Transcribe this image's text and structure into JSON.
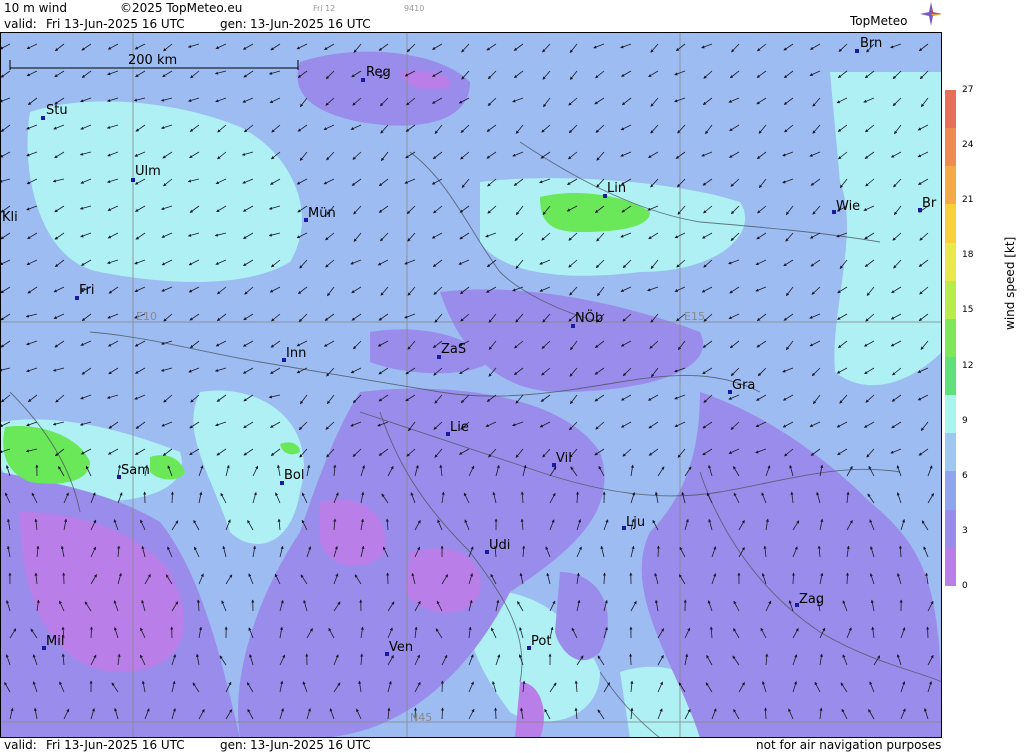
{
  "header": {
    "product": "10 m wind",
    "copyright": "©2025 TopMeteo.eu",
    "tiny_day": "Fri 12",
    "tiny_code": "9410",
    "valid_label": "valid:",
    "valid_time": "Fri 13-Jun-2025 16 UTC",
    "gen_label": "gen:",
    "gen_time": "13-Jun-2025 16 UTC",
    "brand": "TopMeteo"
  },
  "footer": {
    "valid_label": "valid:",
    "valid_time": "Fri 13-Jun-2025 16 UTC",
    "gen_label": "gen:",
    "gen_time": "13-Jun-2025 16 UTC",
    "disclaimer": "not for air navigation purposes"
  },
  "map": {
    "scale_label": "200 km",
    "grid_labels": [
      "E10",
      "E15",
      "N45"
    ],
    "cities": [
      {
        "code": "Reg"
      },
      {
        "code": "Brn"
      },
      {
        "code": "Stu"
      },
      {
        "code": "Ulm"
      },
      {
        "code": "Lin"
      },
      {
        "code": "Mün"
      },
      {
        "code": "Wie"
      },
      {
        "code": "Br"
      },
      {
        "code": "Kli"
      },
      {
        "code": "Fri"
      },
      {
        "code": "NÖb"
      },
      {
        "code": "Inn"
      },
      {
        "code": "ZaS"
      },
      {
        "code": "Gra"
      },
      {
        "code": "Lie"
      },
      {
        "code": "Sam"
      },
      {
        "code": "Bol"
      },
      {
        "code": "Vil"
      },
      {
        "code": "Lju"
      },
      {
        "code": "Udi"
      },
      {
        "code": "Zag"
      },
      {
        "code": "Mil"
      },
      {
        "code": "Ven"
      },
      {
        "code": "Pot"
      }
    ]
  },
  "colorbar": {
    "title": "wind speed  [kt]",
    "ticks": [
      "27",
      "24",
      "21",
      "18",
      "15",
      "12",
      "9",
      "6",
      "3",
      "0"
    ],
    "colors": [
      "#e8705a",
      "#ef8c52",
      "#f4aa46",
      "#f8d03c",
      "#e9e84c",
      "#b8ec4c",
      "#7fe85a",
      "#5fe07a",
      "#a8f4ee",
      "#9ec8f0",
      "#8fa6ee",
      "#9a8cea",
      "#b97ee8"
    ]
  }
}
